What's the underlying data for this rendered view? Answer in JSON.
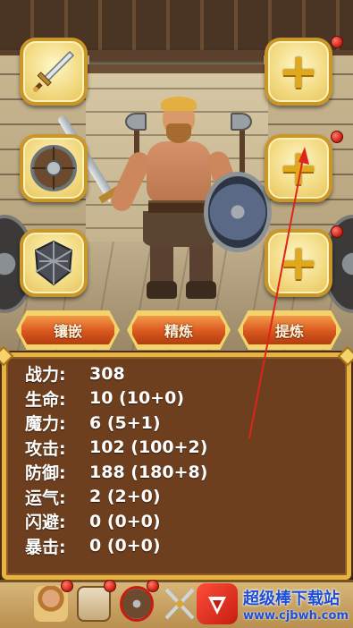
{
  "equipment": {
    "left_slots": [
      {
        "item": "sword",
        "icon": "sword-icon"
      },
      {
        "item": "round-shield",
        "icon": "round-shield-icon"
      },
      {
        "item": "armor",
        "icon": "armor-icon"
      }
    ],
    "right_slots": [
      {
        "item": "empty",
        "icon": "plus-icon",
        "symbol": "+"
      },
      {
        "item": "empty",
        "icon": "plus-icon",
        "symbol": "+"
      },
      {
        "item": "empty",
        "icon": "plus-icon",
        "symbol": "+"
      }
    ]
  },
  "actions": {
    "inlay_label": "镶嵌",
    "refine_label": "精炼",
    "extract_label": "提炼"
  },
  "stats": [
    {
      "label": "战力:",
      "value": "308"
    },
    {
      "label": "生命:",
      "value": "10 (10+0)"
    },
    {
      "label": "魔力:",
      "value": "6 (5+1)"
    },
    {
      "label": "攻击:",
      "value": "102 (100+2)"
    },
    {
      "label": "防御:",
      "value": "188 (180+8)"
    },
    {
      "label": "运气:",
      "value": "2 (2+0)"
    },
    {
      "label": "闪避:",
      "value": "0 (0+0)"
    },
    {
      "label": "暴击:",
      "value": "0 (0+0)"
    }
  ],
  "bottom_tabs": [
    {
      "name": "hero-tab",
      "icon": "hero-portrait-icon"
    },
    {
      "name": "bag-tab",
      "icon": "bag-icon"
    },
    {
      "name": "shield-tab",
      "icon": "shield-icon"
    },
    {
      "name": "battle-tab",
      "icon": "crossed-swords-icon"
    }
  ],
  "watermark": {
    "title": "超级棒下载站",
    "url": "www.cjbwh.com"
  },
  "colors": {
    "slot_border": "#c9962a",
    "plus": "#e0a91a",
    "button": "#d9571e",
    "panel_bg": "#6d3f1f",
    "panel_border": "#e7b341",
    "notification": "#c81c12",
    "annotation_arrow": "#e0241b"
  }
}
